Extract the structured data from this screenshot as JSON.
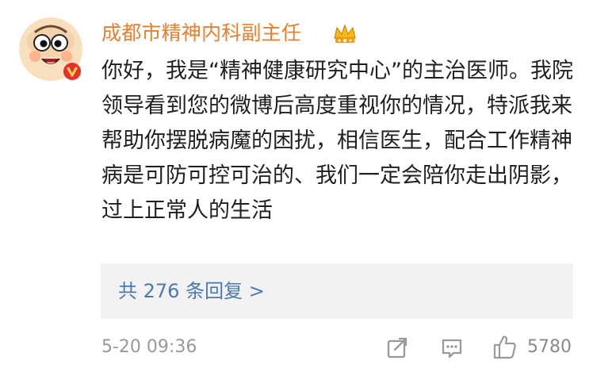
{
  "comment": {
    "username": "成都市精神内科副主任",
    "text": "你好，我是“精神健康研究中心”的主治医师。我院领导看到您的微博后高度重视你的情况，特派我来帮助你摆脱病魔的困扰，相信医生，配合工作精神病是可防可控可治的、我们一定会陪你走出阴影，过上正常人的生活",
    "reply_link": "共 276 条回复 >",
    "timestamp": "5-20 09:36",
    "like_count": "5780",
    "icons": {
      "avatar": "cartoon-face-avatar",
      "verified_badge": "verified-v-icon",
      "vip": "crown-vip-icon",
      "share": "share-icon",
      "comment": "comment-icon",
      "like": "thumbs-up-icon"
    },
    "colors": {
      "username": "#e8802f",
      "link": "#4a79b3",
      "muted": "#999999",
      "reply_bg": "#f2f2f2"
    }
  }
}
